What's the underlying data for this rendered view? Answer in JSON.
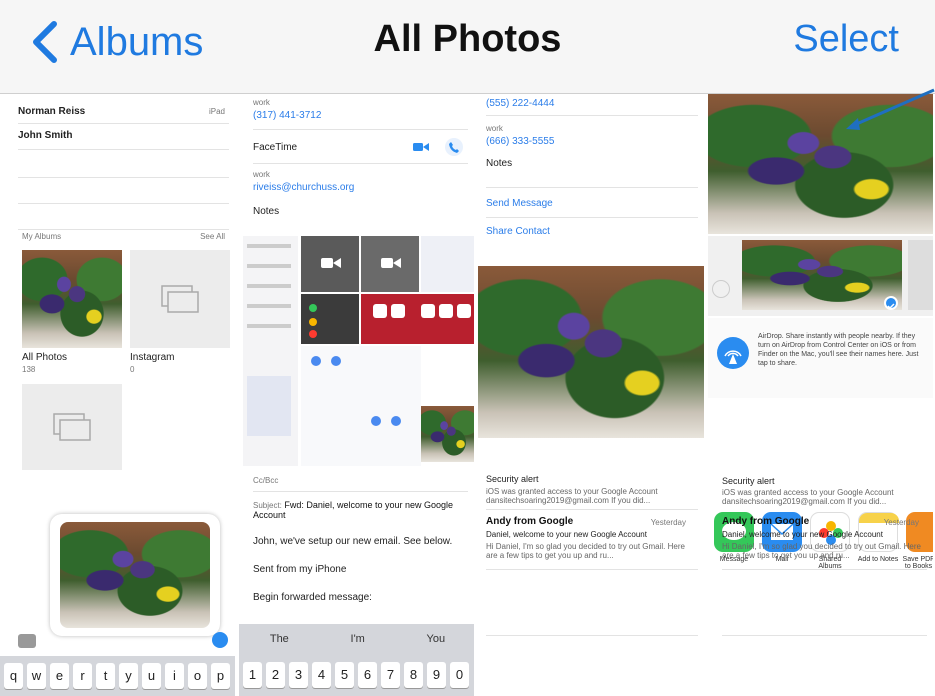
{
  "header": {
    "back_label": "Albums",
    "title": "All Photos",
    "select_label": "Select"
  },
  "tile1": {
    "contacts": [
      "Norman Reiss",
      "John Smith"
    ],
    "contact_meta": "iPad",
    "section_label": "My Albums",
    "section_link": "See All",
    "albums": [
      {
        "name": "All Photos",
        "count": "138"
      },
      {
        "name": "Instagram",
        "count": "0"
      }
    ],
    "keyboard_row": [
      "q",
      "w",
      "e",
      "r",
      "t",
      "y",
      "u",
      "i",
      "o",
      "p"
    ]
  },
  "tile2": {
    "work_label": "work",
    "phone": "(317) 441-3712",
    "facetime_label": "FaceTime",
    "email_work_label": "work",
    "email": "riveiss@churchuss.org",
    "notes_label": "Notes",
    "cc_label": "Cc/Bcc",
    "subject_label": "Subject:",
    "subject": "Fwd: Daniel, welcome to your new Google Account",
    "body_line1": "John, we've setup our new email. See below.",
    "body_line2": "Sent from my iPhone",
    "body_line3": "Begin forwarded message:",
    "suggestions": [
      "The",
      "I'm",
      "You"
    ],
    "number_row": [
      "1",
      "2",
      "3",
      "4",
      "5",
      "6",
      "7",
      "8",
      "9",
      "0"
    ]
  },
  "tile3": {
    "phone1": "(555) 222-4444",
    "work_label": "work",
    "phone2": "(666) 333-5555",
    "notes_label": "Notes",
    "send_message": "Send Message",
    "share_contact": "Share Contact",
    "alert_title": "Security alert",
    "alert_text": "iOS was granted access to your Google Account dansitechsoaring2019@gmail.com If you did...",
    "sender": "Andy from Google",
    "sender_time": "Yesterday",
    "mail_subject": "Daniel, welcome to your new Google Account",
    "mail_preview": "Hi Daniel, I'm so glad you decided to try out Gmail. Here are a few tips to get you up and ru..."
  },
  "tile4": {
    "airdrop_text": "AirDrop. Share instantly with people nearby. If they turn on AirDrop from Control Center on iOS or from Finder on the Mac, you'll see their names here. Just tap to share.",
    "apps": [
      {
        "label": "Message",
        "color": "#34c759"
      },
      {
        "label": "Mail",
        "color": "#2a8cf0"
      },
      {
        "label": "Shared Albums",
        "color": "#ffffff"
      },
      {
        "label": "Add to Notes",
        "color": "#f7d24a"
      },
      {
        "label": "Save PDF to Books",
        "color": "#f08a22"
      }
    ],
    "alert_title": "Security alert",
    "alert_text": "iOS was granted access to your Google Account dansitechsoaring2019@gmail.com If you did...",
    "sender": "Andy from Google",
    "sender_time": "Yesterday",
    "mail_subject": "Daniel, welcome to your new Google Account",
    "mail_preview": "Hi Daniel, I'm so glad you decided to try out Gmail. Here are a few tips to get you up and ru..."
  },
  "colors": {
    "accent": "#1f7ae0",
    "header_bg": "#f6f6f6",
    "arrow": "#1f6fc0"
  }
}
